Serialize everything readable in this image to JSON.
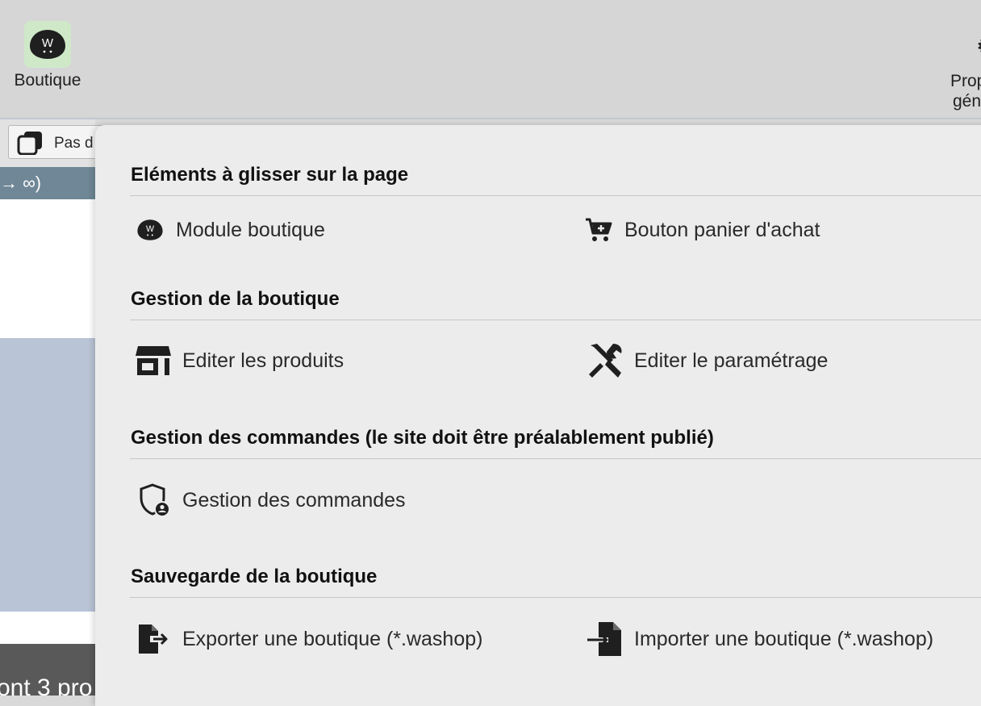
{
  "toolbar": {
    "boutique_label": "Boutique",
    "props_label_line1": "Prop",
    "props_label_line2": "gén"
  },
  "background": {
    "page_select_text": "Pas d",
    "strip_text": "→ ∞)",
    "bottom_text": "ont 3 pro"
  },
  "panel": {
    "sections": {
      "drag": {
        "title": "Eléments à glisser sur la page",
        "module_label": "Module boutique",
        "cart_label": "Bouton panier d'achat"
      },
      "manage": {
        "title": "Gestion de la boutique",
        "products_label": "Editer les produits",
        "settings_label": "Editer le paramétrage"
      },
      "orders": {
        "title": "Gestion des commandes (le site doit être préalablement publié)",
        "orders_label": "Gestion des commandes"
      },
      "backup": {
        "title": "Sauvegarde de la boutique",
        "export_label": "Exporter une boutique (*.washop)",
        "import_label": "Importer une boutique (*.washop)"
      }
    }
  },
  "icons": {
    "boutique": "wa-shop-logo-icon",
    "module": "wa-shop-logo-icon",
    "cart": "cart-plus-icon",
    "store": "store-icon",
    "tools": "tools-icon",
    "orders": "shield-user-icon",
    "export": "file-export-icon",
    "import": "file-import-icon"
  },
  "colors": {
    "logo_bg": "#cfe9c8",
    "panel_bg": "#ececec",
    "toolbar_bg": "#d6d6d6"
  }
}
